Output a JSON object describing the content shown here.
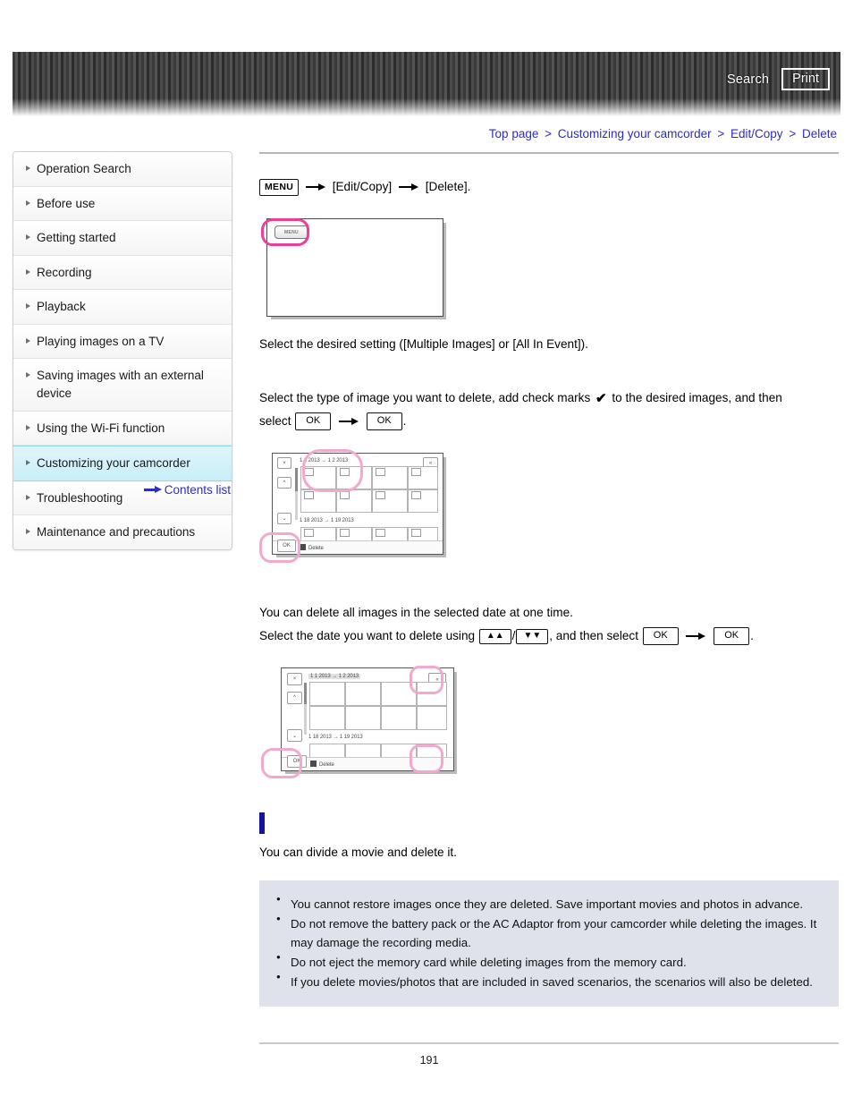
{
  "header": {
    "search_label": "Search",
    "print_label": "Print",
    "search_icon": "search-icon",
    "print_icon": "print-icon"
  },
  "breadcrumb": {
    "separator": ">",
    "items": [
      {
        "label": "Top page"
      },
      {
        "label": "Customizing your camcorder"
      },
      {
        "label": "Edit/Copy"
      },
      {
        "label": "Delete"
      }
    ]
  },
  "sidebar": {
    "items": [
      {
        "label": "Operation Search",
        "active": false
      },
      {
        "label": "Before use",
        "active": false
      },
      {
        "label": "Getting started",
        "active": false
      },
      {
        "label": "Recording",
        "active": false
      },
      {
        "label": "Playback",
        "active": false
      },
      {
        "label": "Playing images on a TV",
        "active": false
      },
      {
        "label": "Saving images with an external device",
        "active": false
      },
      {
        "label": "Using the Wi-Fi function",
        "active": false
      },
      {
        "label": "Customizing your camcorder",
        "active": true
      },
      {
        "label": "Troubleshooting",
        "active": false
      },
      {
        "label": "Maintenance and precautions",
        "active": false
      }
    ],
    "contents_link": "Contents list"
  },
  "main": {
    "step1": {
      "menu_button": "MENU",
      "item1": "[Edit/Copy]",
      "item2": "[Delete].",
      "arrow": "→"
    },
    "step2_text": "Select the desired setting ([Multiple Images] or [All In Event]).",
    "step3_text_a": "Select the type of image you want to delete, add check marks",
    "step3_text_b": "to the desired images, and then",
    "step3_text_c": "select",
    "step3_ok1": "OK",
    "step3_ok2": "OK",
    "step3_period": ".",
    "step4_line1": "You can delete all images in the selected date at one time.",
    "step4_line2_a": "Select the date you want to delete using",
    "step4_sep": "/",
    "step4_line2_b": ", and then select",
    "step4_ok1": "OK",
    "step4_ok2": "OK",
    "step4_period": ".",
    "chev_up": "»",
    "chev_down": "»",
    "divide_text": "You can divide a movie and delete it."
  },
  "lcd1": {
    "menu_chip_label": "MENU"
  },
  "lcd2": {
    "close_label": "×",
    "date_top": "1 1 2013 → 1 2 2013",
    "date_bottom": "1 18 2013 → 1 19 2013",
    "ok_label": "OK",
    "delete_label": "Delete",
    "up_label": "^",
    "down_label": "⌄",
    "jump_up_label": "«",
    "jump_down_label": "»"
  },
  "lcd3": {
    "close_label": "×",
    "date_top": "1 1 2013 → 1 2 2013",
    "date_bottom": "1 18 2013 → 1 19 2013",
    "ok_label": "OK",
    "delete_label": "Delete",
    "up_label": "^",
    "down_label": "⌄",
    "jump_up_label": "«",
    "jump_down_label": "»"
  },
  "notes": {
    "items": [
      "You cannot restore images once they are deleted. Save important movies and photos in advance.",
      "Do not remove the battery pack or the AC Adaptor from your camcorder while deleting the images. It may damage the recording media.",
      "Do not eject the memory card while deleting images from the memory card.",
      "If you delete movies/photos that are included in saved scenarios, the scenarios will also be deleted."
    ]
  },
  "footer": {
    "page_number": "191"
  },
  "colors": {
    "link": "#2c2cc8",
    "highlight_ring": "#ee3d96",
    "sidebar_active": "#c9eef8",
    "note_bg": "#dfe2ea",
    "section_mark": "#1414a0"
  }
}
